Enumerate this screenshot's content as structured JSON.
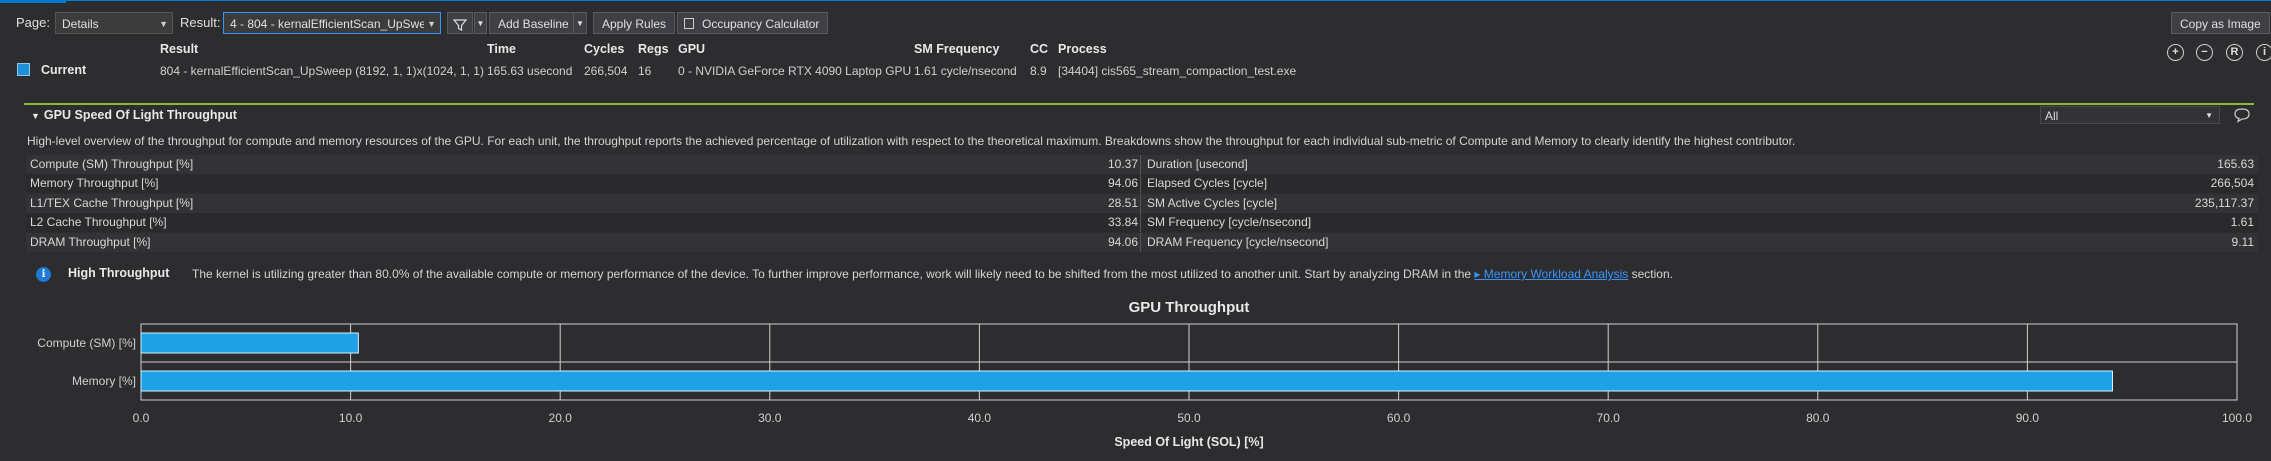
{
  "toolbar": {
    "page_label": "Page:",
    "page_value": "Details",
    "result_label": "Result:",
    "result_value": "4 -  804 - kernalEfficientScan_UpSwe",
    "add_baseline": "Add Baseline",
    "apply_rules": "Apply Rules",
    "occupancy": "Occupancy Calculator",
    "copy_image": "Copy as Image"
  },
  "header": {
    "columns": [
      "Result",
      "Time",
      "Cycles",
      "Regs",
      "GPU",
      "SM Frequency",
      "CC",
      "Process"
    ],
    "current_label": "Current",
    "result": "804 - kernalEfficientScan_UpSweep (8192, 1, 1)x(1024, 1, 1)",
    "time": "165.63 usecond",
    "cycles": "266,504",
    "regs": "16",
    "gpu": "0 - NVIDIA GeForce RTX 4090 Laptop GPU",
    "sm_freq": "1.61 cycle/nsecond",
    "cc": "8.9",
    "process": "[34404] cis565_stream_compaction_test.exe"
  },
  "section": {
    "title": "GPU Speed Of Light Throughput",
    "filter": "All",
    "description": "High-level overview of the throughput for compute and memory resources of the GPU. For each unit, the throughput reports the achieved percentage of utilization with respect to the theoretical maximum. Breakdowns show the throughput for each individual sub-metric of Compute and Memory to clearly identify the highest contributor."
  },
  "metrics": [
    {
      "left_name": "Compute (SM) Throughput [%]",
      "left_value": "10.37",
      "right_name": "Duration [usecond]",
      "right_value": "165.63"
    },
    {
      "left_name": "Memory Throughput [%]",
      "left_value": "94.06",
      "right_name": "Elapsed Cycles [cycle]",
      "right_value": "266,504"
    },
    {
      "left_name": "L1/TEX Cache Throughput [%]",
      "left_value": "28.51",
      "right_name": "SM Active Cycles [cycle]",
      "right_value": "235,117.37"
    },
    {
      "left_name": "L2 Cache Throughput [%]",
      "left_value": "33.84",
      "right_name": "SM Frequency [cycle/nsecond]",
      "right_value": "1.61"
    },
    {
      "left_name": "DRAM Throughput [%]",
      "left_value": "94.06",
      "right_name": "DRAM Frequency [cycle/nsecond]",
      "right_value": "9.11"
    }
  ],
  "info": {
    "title": "High Throughput",
    "text": "The kernel is utilizing greater than 80.0% of the available compute or memory performance of the device. To further improve performance, work will likely need to be shifted from the most utilized to another unit. Start by analyzing DRAM in the",
    "link": "▸ Memory Workload Analysis",
    "suffix": "section."
  },
  "chart_data": {
    "type": "bar",
    "orientation": "horizontal",
    "title": "GPU Throughput",
    "xlabel": "Speed Of Light (SOL) [%]",
    "ylabel": "",
    "categories": [
      "Compute (SM) [%]",
      "Memory [%]"
    ],
    "values": [
      10.37,
      94.06
    ],
    "xlim": [
      0,
      100
    ],
    "xticks": [
      "0.0",
      "10.0",
      "20.0",
      "30.0",
      "40.0",
      "50.0",
      "60.0",
      "70.0",
      "80.0",
      "90.0",
      "100.0"
    ],
    "grid": true,
    "bar_color": "#1ea1e6"
  }
}
